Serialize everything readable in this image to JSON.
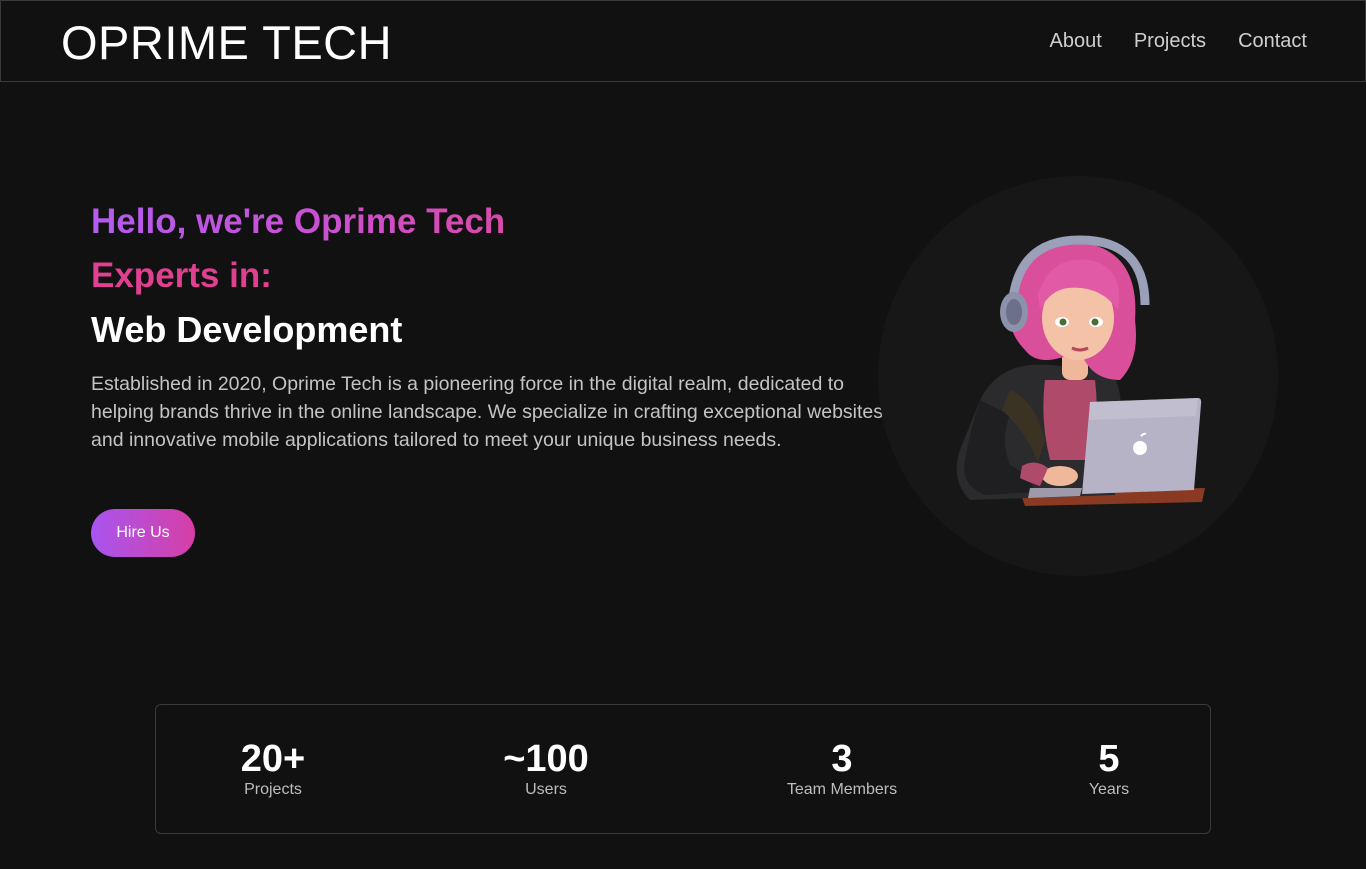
{
  "header": {
    "brand": "OPRIME TECH",
    "nav": [
      "About",
      "Projects",
      "Contact"
    ]
  },
  "hero": {
    "greeting": "Hello, we're Oprime Tech",
    "experts_label": "Experts in:",
    "skill": "Web Development",
    "description": "Established in 2020, Oprime Tech is a pioneering force in the digital realm, dedicated to helping brands thrive in the online landscape. We specialize in crafting exceptional websites and innovative mobile applications tailored to meet your unique business needs.",
    "cta_label": "Hire Us"
  },
  "stats": [
    {
      "value": "20+",
      "label": "Projects"
    },
    {
      "value": "~100",
      "label": "Users"
    },
    {
      "value": "3",
      "label": "Team Members"
    },
    {
      "value": "5",
      "label": "Years"
    }
  ],
  "colors": {
    "background": "#111111",
    "accent_purple": "#b35cf0",
    "accent_pink": "#e0408f"
  }
}
